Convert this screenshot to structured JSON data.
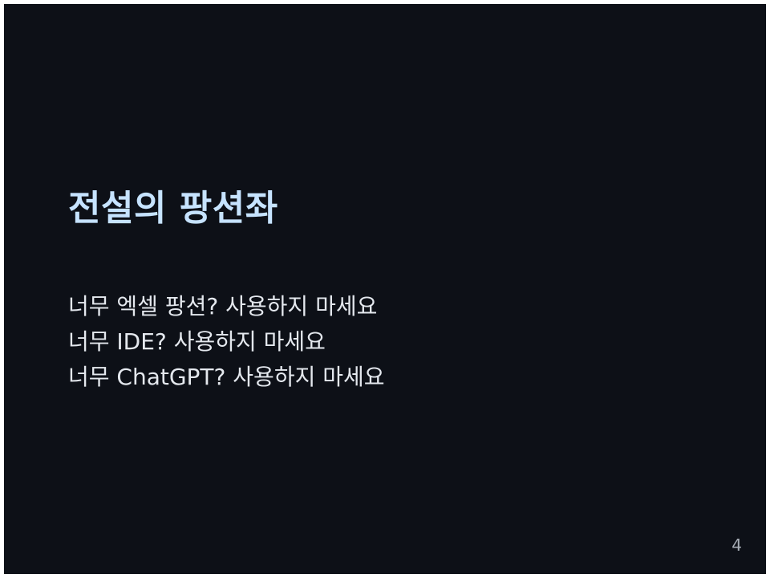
{
  "slide": {
    "title": "전설의 팡션좌",
    "lines": [
      "너무 엑셀 팡션? 사용하지 마세요",
      "너무 IDE? 사용하지 마세요",
      "너무 ChatGPT? 사용하지 마세요"
    ],
    "page_number": "4",
    "colors": {
      "background": "#0d1017",
      "title": "#c6e3ff",
      "body_text": "#e4e8ee",
      "page_number": "#a7adb6"
    }
  }
}
